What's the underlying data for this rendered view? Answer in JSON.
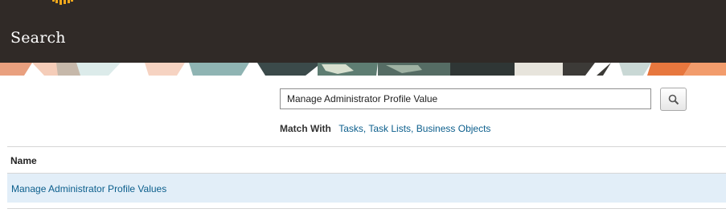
{
  "header": {
    "title": "Search",
    "logo_icon": "oracle-sun-logo-icon",
    "colors": {
      "header_bg": "#302a27",
      "logo": "#f0a81c"
    }
  },
  "banner": {
    "description_icon": "decorative-banner-pattern"
  },
  "search": {
    "value": "Manage Administrator Profile Value",
    "button_icon": "magnifier-icon",
    "match_label": "Match With",
    "match_value": "Tasks, Task Lists, Business Objects"
  },
  "results": {
    "column_header": "Name",
    "rows": [
      {
        "name": "Manage Administrator Profile Values",
        "selected": true
      }
    ],
    "colors": {
      "selected_row_bg": "#e2eef8",
      "link": "#0b5e8c"
    }
  }
}
